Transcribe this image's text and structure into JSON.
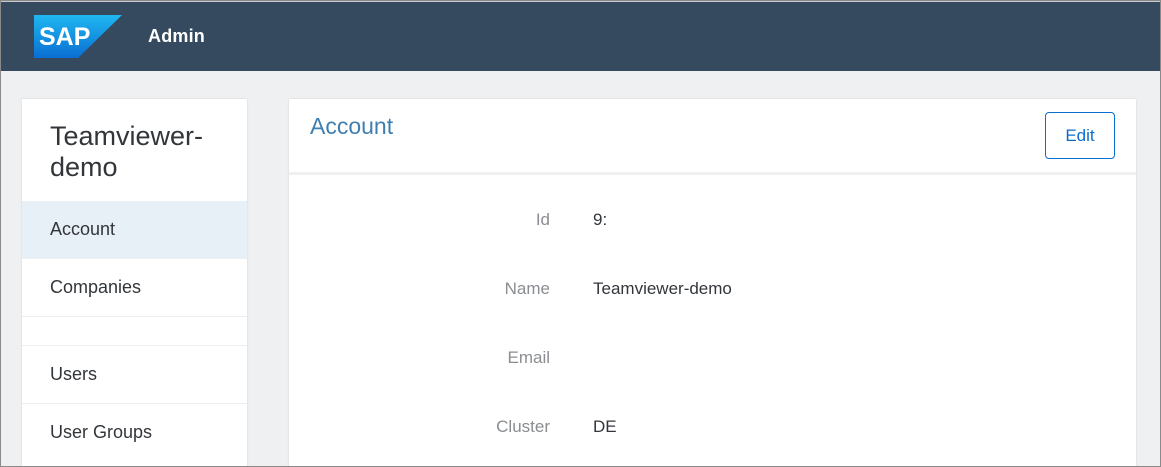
{
  "shell": {
    "logo_text": "SAP",
    "app_title": "Admin",
    "header_color": "#354a5f"
  },
  "sidebar": {
    "title": "Teamviewer-demo",
    "items": [
      {
        "label": "Account",
        "selected": true
      },
      {
        "label": "Companies",
        "selected": false
      },
      {
        "label": "Users",
        "selected": false
      },
      {
        "label": "User Groups",
        "selected": false
      }
    ]
  },
  "account": {
    "title": "Account",
    "edit_label": "Edit",
    "fields": [
      {
        "label": "Id",
        "value": "9:"
      },
      {
        "label": "Name",
        "value": "Teamviewer-demo"
      },
      {
        "label": "Email",
        "value": ""
      },
      {
        "label": "Cluster",
        "value": "DE"
      }
    ]
  },
  "colors": {
    "accent": "#0a6ed1",
    "title_blue": "#3f7fb0",
    "selected_bg": "#e7f0f7",
    "page_bg": "#eef0f2"
  }
}
